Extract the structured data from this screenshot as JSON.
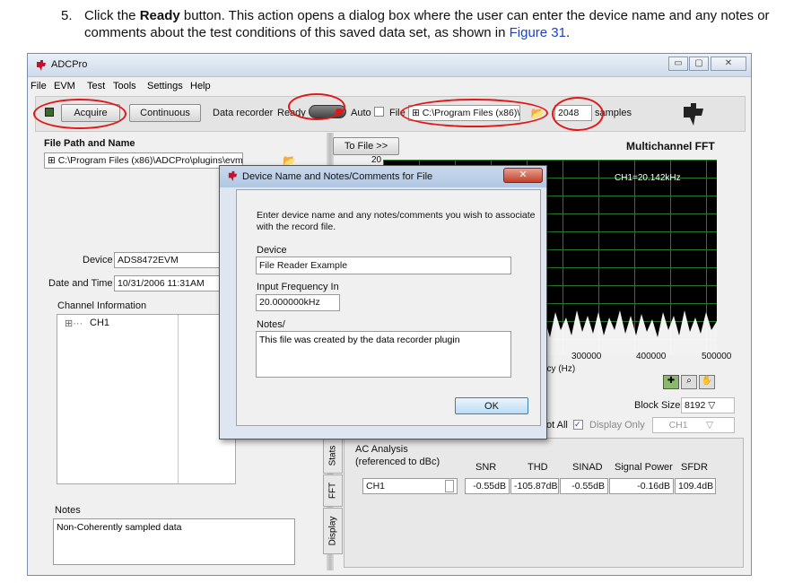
{
  "instruction": {
    "number": "5.",
    "pre": "Click the ",
    "bold": "Ready",
    "post": " button. This action opens a dialog box where the user can enter the device name and any notes or comments about the test conditions of this saved data set, as shown in ",
    "link": "Figure 31",
    "end": "."
  },
  "window": {
    "title": "ADCPro",
    "controls": {
      "min": "▭",
      "max": "▢",
      "close": "✕"
    },
    "menu": [
      "File",
      "EVM",
      "Test",
      "Tools",
      "Settings",
      "Help"
    ]
  },
  "toolbar": {
    "acquire": "Acquire",
    "continuous": "Continuous",
    "data_recorder": "Data recorder",
    "ready": "Ready",
    "auto": "Auto",
    "file": "File",
    "file_path": "C:\\Program Files (x86)\\",
    "samples_value": "2048",
    "samples": "samples"
  },
  "left": {
    "file_path_label": "File Path and Name",
    "file_path_value": "C:\\Program Files (x86)\\ADCPro\\plugins\\evm\\",
    "device_label": "Device",
    "device_value": "ADS8472EVM",
    "datetime_label": "Date and Time",
    "datetime_value": "10/31/2006 11:31AM",
    "channel_info_label": "Channel Information",
    "channel_item": "CH1",
    "notes_label": "Notes",
    "notes_value": "Non-Coherently sampled data"
  },
  "right": {
    "to_file": "To File >>",
    "chart_title": "Multichannel FFT",
    "ytick_top": "20",
    "legend": "CH1=20.142kHz",
    "xticks": [
      "300000",
      "400000",
      "500000"
    ],
    "xlabel_partial": "ncy (Hz)",
    "block_size_label": "Block Size",
    "block_size_value": "8192",
    "plot_all_partial": "ot All",
    "display_only": "Display Only",
    "display_ch": "CH1",
    "tabs": [
      "Stats",
      "FFT",
      "Display"
    ],
    "ac_analysis": "AC Analysis",
    "referenced": "(referenced to dBc)",
    "table_headers": [
      "SNR",
      "THD",
      "SINAD",
      "Signal Power",
      "SFDR"
    ],
    "table_row_label": "CH1",
    "table_values": [
      "-0.55dB",
      "-105.87dB",
      "-0.55dB",
      "-0.16dB",
      "109.4dB"
    ]
  },
  "dialog": {
    "title": "Device Name and Notes/Comments for File",
    "intro": "Enter device name and any notes/comments you wish to associate with the record file.",
    "device_label": "Device",
    "device_value": "File Reader Example",
    "freq_label": "Input Frequency In",
    "freq_value": "20.000000kHz",
    "notes_label": "Notes/",
    "notes_value": "This file was created by the data recorder plugin",
    "ok": "OK"
  },
  "colors": {
    "accent": "#1f3fbf",
    "annotation": "#e01818",
    "chart_grid": "#2f8f2f"
  }
}
